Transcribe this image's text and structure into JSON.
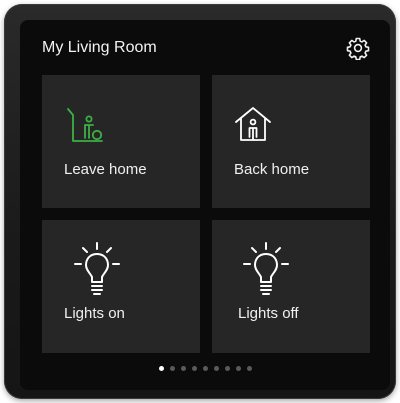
{
  "header": {
    "title": "My Living Room",
    "settings_icon": "gear-icon"
  },
  "tiles": [
    {
      "label": "Leave home",
      "icon": "leave-home-icon",
      "icon_color": "#3cb043"
    },
    {
      "label": "Back home",
      "icon": "back-home-icon",
      "icon_color": "#ffffff"
    },
    {
      "label": "Lights on",
      "icon": "lightbulb-on-icon",
      "icon_color": "#ffffff"
    },
    {
      "label": "Lights off",
      "icon": "lightbulb-off-icon",
      "icon_color": "#ffffff"
    }
  ],
  "pager": {
    "page_count": 9,
    "current_page": 1
  },
  "colors": {
    "background": "#0b0b0b",
    "tile": "#262626",
    "text": "#f0f0f0",
    "accent": "#3cb043",
    "dot_inactive": "#5a5a5a",
    "dot_active": "#ffffff"
  }
}
